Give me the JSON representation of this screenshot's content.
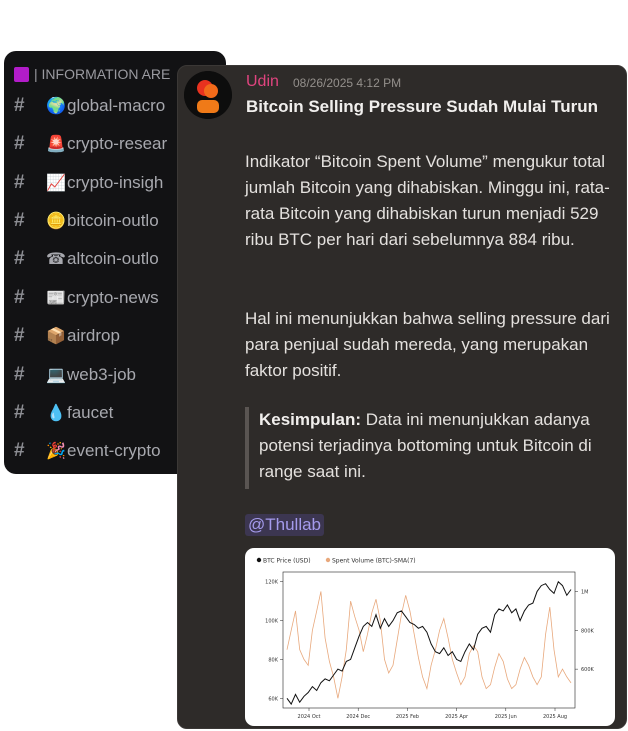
{
  "sidebar": {
    "category": "| INFORMATION ARE",
    "channels": [
      {
        "emoji": "🌍",
        "name": "global-macro"
      },
      {
        "emoji": "🚨",
        "name": "crypto-resear"
      },
      {
        "emoji": "📈",
        "name": "crypto-insigh"
      },
      {
        "emoji": "🪙",
        "name": "bitcoin-outlo"
      },
      {
        "emoji": "☎",
        "name": "altcoin-outlo"
      },
      {
        "emoji": "📰",
        "name": "crypto-news"
      },
      {
        "emoji": "📦",
        "name": "airdrop"
      },
      {
        "emoji": "💻",
        "name": "web3-job"
      },
      {
        "emoji": "💧",
        "name": "faucet"
      },
      {
        "emoji": "🎉",
        "name": "event-crypto"
      }
    ]
  },
  "message": {
    "author": "Udin",
    "timestamp": "08/26/2025 4:12 PM",
    "title": "Bitcoin Selling Pressure Sudah Mulai Turun",
    "paragraph1": "Indikator “Bitcoin Spent Volume” mengukur total jumlah Bitcoin yang dihabiskan. Minggu ini, rata-rata Bitcoin yang dihabiskan turun menjadi 529 ribu BTC per hari dari sebelumnya 884 ribu.",
    "paragraph2": "Hal ini menunjukkan bahwa selling pressure dari para penjual sudah mereda, yang merupakan faktor positif.",
    "quote_label": "Kesimpulan:",
    "quote_text": " Data ini menunjukkan adanya potensi terjadinya bottoming untuk Bitcoin di range saat ini.",
    "mention": "@Thullab"
  },
  "colors": {
    "author": "#e0447f",
    "price_line": "#111111",
    "volume_line": "#e8a87c",
    "mention": "#a59bec"
  },
  "chart_data": {
    "type": "line",
    "legend": [
      "BTC Price (USD)",
      "Spent Volume (BTC)-SMA(7)"
    ],
    "x_ticks": [
      "2024 Oct",
      "2024 Dec",
      "2025 Feb",
      "2025 Apr",
      "2025 Jun",
      "2025 Aug"
    ],
    "y_left_ticks": [
      "120K",
      "100K",
      "80K",
      "60K"
    ],
    "y_right_ticks": [
      "1M",
      "800K",
      "600K"
    ],
    "ylim_left": [
      55000,
      125000
    ],
    "ylim_right": [
      400000,
      1100000
    ],
    "series": [
      {
        "name": "BTC Price (USD)",
        "axis": "left",
        "values": [
          60000,
          57000,
          62000,
          58000,
          61000,
          63000,
          66000,
          64000,
          68000,
          70000,
          69000,
          72000,
          75000,
          74000,
          79000,
          80000,
          86000,
          92000,
          97000,
          99000,
          97000,
          103000,
          96000,
          101000,
          97000,
          100000,
          104000,
          105000,
          102000,
          99000,
          98000,
          96000,
          97000,
          94000,
          88000,
          84000,
          83000,
          86000,
          82000,
          84000,
          80000,
          79000,
          84000,
          88000,
          85000,
          93000,
          96000,
          97000,
          94000,
          103000,
          106000,
          105000,
          108000,
          104000,
          106000,
          100000,
          105000,
          108000,
          109000,
          115000,
          118000,
          119000,
          116000,
          114000,
          120000,
          118000,
          113000,
          116000
        ]
      },
      {
        "name": "Spent Volume (BTC)-SMA(7)",
        "axis": "right",
        "values": [
          700000,
          800000,
          900000,
          700000,
          650000,
          620000,
          800000,
          900000,
          1000000,
          760000,
          640000,
          560000,
          450000,
          560000,
          700000,
          950000,
          870000,
          800000,
          690000,
          780000,
          890000,
          960000,
          850000,
          650000,
          580000,
          620000,
          750000,
          880000,
          980000,
          900000,
          780000,
          660000,
          560000,
          500000,
          620000,
          700000,
          800000,
          860000,
          760000,
          650000,
          580000,
          520000,
          560000,
          680000,
          720000,
          690000,
          560000,
          500000,
          520000,
          610000,
          680000,
          640000,
          550000,
          500000,
          520000,
          600000,
          660000,
          620000,
          560000,
          520000,
          560000,
          780000,
          920000,
          700000,
          560000,
          600000,
          560000,
          529000
        ]
      }
    ]
  }
}
